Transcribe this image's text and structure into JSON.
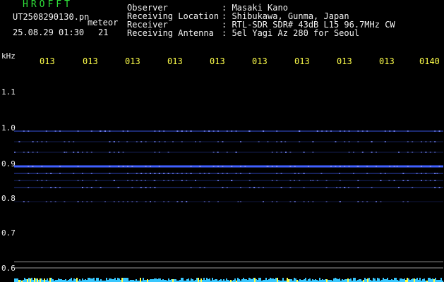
{
  "app": {
    "title": "HROFFT"
  },
  "info": {
    "file_name": "UT2508290130.pn",
    "mode": "meteor",
    "datetime": "25.08.29 01:30",
    "count": "21"
  },
  "header": {
    "observer_key": "Observer",
    "observer_val": ": Masaki Kano",
    "location_key": "Receiving Location",
    "location_val": ": Shibukawa, Gunma, Japan",
    "receiver_key": "Receiver",
    "receiver_val": ": RTL-SDR SDR# 43dB L15 96.7MHz CW",
    "antenna_key": "Receiving Antenna",
    "antenna_val": ": 5el Yagi Az 280 for Seoul"
  },
  "axis": {
    "unit": "kHz",
    "freq_ticks": [
      "1.1",
      "1.0",
      "0.9",
      "0.8",
      "0.7",
      "0.6"
    ],
    "time_ticks": [
      "013",
      "013",
      "013",
      "013",
      "013",
      "013",
      "013",
      "013",
      "013",
      "0140"
    ]
  },
  "colors": {
    "bg": "#000000",
    "signal": "#4060ff",
    "title": "#2fe23a",
    "ticks": "#ffff4a"
  },
  "chart_data": {
    "type": "heatmap",
    "ylabel": "kHz",
    "ylim": [
      0.6,
      1.15
    ],
    "bands": [
      {
        "freq": 0.99,
        "intensity": 0.55
      },
      {
        "freq": 0.96,
        "intensity": 0.2
      },
      {
        "freq": 0.93,
        "intensity": 0.2
      },
      {
        "freq": 0.89,
        "intensity": 1.0
      },
      {
        "freq": 0.87,
        "intensity": 0.45
      },
      {
        "freq": 0.85,
        "intensity": 0.25
      },
      {
        "freq": 0.83,
        "intensity": 0.35
      },
      {
        "freq": 0.79,
        "intensity": 0.15
      }
    ],
    "reference_lines": [
      0.62,
      0.603
    ]
  }
}
